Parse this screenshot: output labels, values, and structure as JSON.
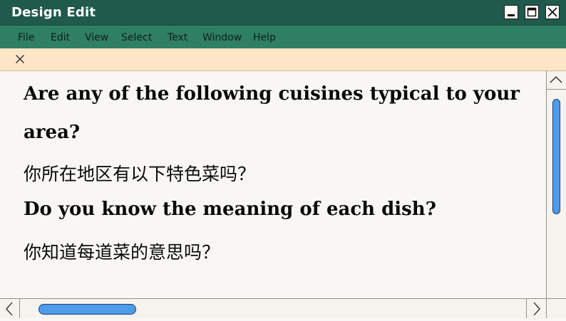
{
  "window": {
    "title": "Design Edit",
    "controls": {
      "minimize_icon": "minimize-icon",
      "maximize_icon": "maximize-icon",
      "close_icon": "close-icon"
    }
  },
  "menu": {
    "items": [
      "File",
      "Edit",
      "View",
      "Select",
      "Text",
      "Window",
      "Help"
    ]
  },
  "tab": {
    "close_icon": "close-icon"
  },
  "document": {
    "lines": [
      "Are any of the following cuisines typical to your",
      "area?",
      "你所在地区有以下特色菜吗？",
      "Do you know the meaning of each dish?",
      "你知道每道菜的意思吗？"
    ]
  },
  "scrollbars": {
    "vertical": {
      "position": 0.0,
      "up_icon": "chevron-up-icon"
    },
    "horizontal": {
      "position": 0.0,
      "left_icon": "chevron-left-icon",
      "right_icon": "chevron-right-icon"
    }
  },
  "colors": {
    "titlebar": "#1f5a4c",
    "menubar": "#2f7f64",
    "tabstrip": "#fde5c5",
    "content_bg": "#f8f7f3",
    "scroll_thumb": "#4e9bea"
  }
}
